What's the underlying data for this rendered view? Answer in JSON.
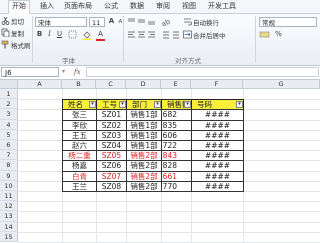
{
  "tabs": [
    "开始",
    "插入",
    "页面布局",
    "公式",
    "数据",
    "审阅",
    "视图",
    "开发工具"
  ],
  "clipboard": {
    "cut": "剪切",
    "copy": "复制",
    "format_painter": "格式刷",
    "paste_label": "粘贴"
  },
  "font": {
    "name": "宋体",
    "size": "11",
    "group_label": "字体",
    "bold": "B",
    "italic": "I",
    "underline": "U",
    "grow": "A",
    "shrink": "A",
    "font_color_icon": "A"
  },
  "alignment": {
    "wrap": "自动换行",
    "merge": "合并后居中",
    "group_label": "对齐方式"
  },
  "number": {
    "format": "常规",
    "percent": "%"
  },
  "formula_bar": {
    "name_box": "J6",
    "fx": "fx"
  },
  "columns": [
    "A",
    "B",
    "C",
    "D",
    "E",
    "F",
    "G"
  ],
  "rows": [
    "1",
    "2",
    "3",
    "4",
    "5",
    "6",
    "7",
    "8",
    "9",
    "10",
    "11",
    "12",
    "13",
    "14",
    "15"
  ],
  "table": {
    "headers": [
      "姓名",
      "工号",
      "部门",
      "销售额",
      "号码"
    ],
    "rows": [
      {
        "name": "张三",
        "id": "SZ01",
        "dept": "销售1部",
        "sales": "682",
        "phone": "####",
        "red": false
      },
      {
        "name": "李欣",
        "id": "SZ02",
        "dept": "销售1部",
        "sales": "835",
        "phone": "####",
        "red": false
      },
      {
        "name": "王五",
        "id": "SZ03",
        "dept": "销售1部",
        "sales": "606",
        "phone": "####",
        "red": false
      },
      {
        "name": "赵六",
        "id": "SZ04",
        "dept": "销售1部",
        "sales": "722",
        "phone": "####",
        "red": false
      },
      {
        "name": "杨二重",
        "id": "SZ05",
        "dept": "销售2部",
        "sales": "843",
        "phone": "####",
        "red": true
      },
      {
        "name": "杨嘉",
        "id": "SZ06",
        "dept": "销售2部",
        "sales": "828",
        "phone": "####",
        "red": false
      },
      {
        "name": "白青",
        "id": "SZ07",
        "dept": "销售2部",
        "sales": "661",
        "phone": "####",
        "red": true
      },
      {
        "name": "王兰",
        "id": "SZ08",
        "dept": "销售2部",
        "sales": "770",
        "phone": "####",
        "red": false
      }
    ]
  },
  "colors": {
    "header_fill": "#f7ef3a",
    "red_text": "#e02020",
    "accent": "#2a5ea8"
  }
}
